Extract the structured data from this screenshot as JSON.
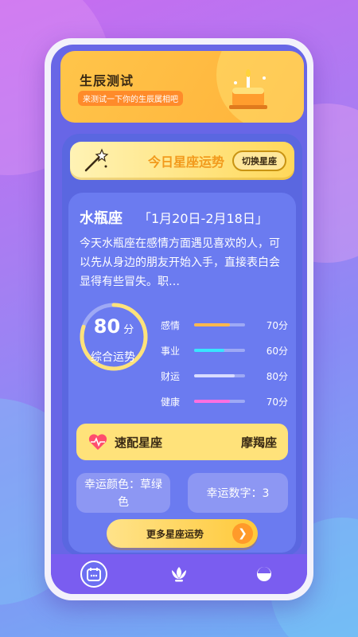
{
  "banner": {
    "title": "生辰测试",
    "subtitle": "来测试一下你的生辰属相吧"
  },
  "fortune": {
    "title": "今日星座运势",
    "switch_label": "切换星座"
  },
  "sign": {
    "name": "水瓶座",
    "dates": "「1月20日-2月18日」",
    "description": "今天水瓶座在感情方面遇见喜欢的人，可以先从身边的朋友开始入手，直接表白会显得有些冒失。职…"
  },
  "overall": {
    "score": "80",
    "unit": "分",
    "label": "综合运势",
    "value": 0.8
  },
  "stats": [
    {
      "label": "感情",
      "value_text": "70分",
      "value": 0.7,
      "color": "#ffb84d"
    },
    {
      "label": "事业",
      "value_text": "60分",
      "value": 0.6,
      "color": "#38e5ff"
    },
    {
      "label": "财运",
      "value_text": "80分",
      "value": 0.8,
      "color": "#d9dcff"
    },
    {
      "label": "健康",
      "value_text": "70分",
      "value": 0.7,
      "color": "#ff6fe0"
    }
  ],
  "match": {
    "label": "速配星座",
    "sign": "摩羯座"
  },
  "lucky": {
    "color_text": "幸运颜色：草绿色",
    "number_text": "幸运数字：3"
  },
  "more_button": "更多星座运势",
  "tabs": [
    "calendar-icon",
    "lotus-icon",
    "face-icon"
  ]
}
